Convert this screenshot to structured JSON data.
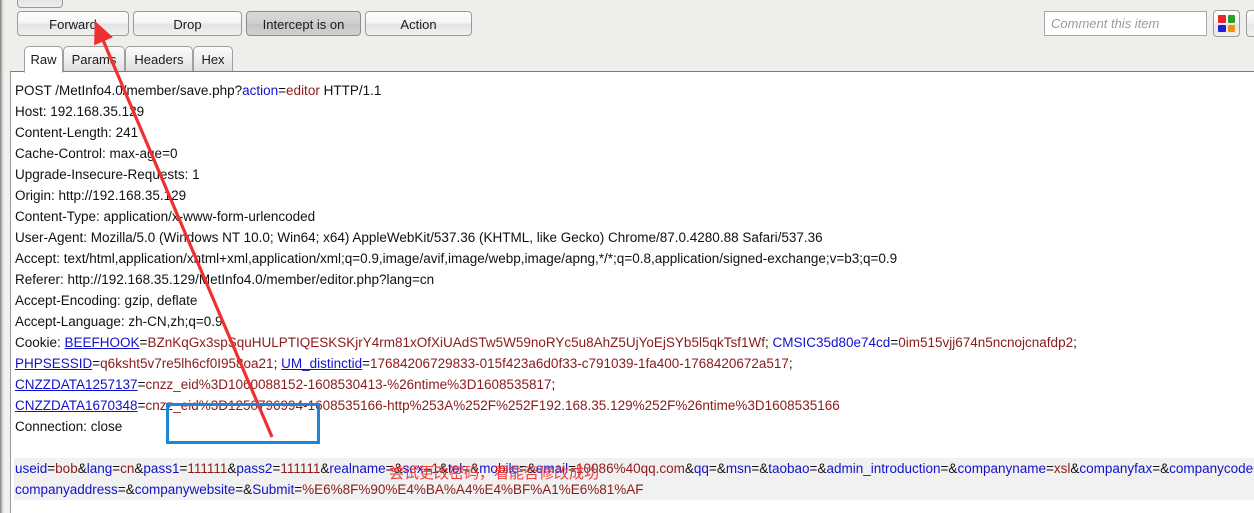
{
  "toolbar": {
    "forward_label": "Forward",
    "drop_label": "Drop",
    "intercept_label": "Intercept is on",
    "action_label": "Action",
    "comment_placeholder": "Comment this item",
    "help_glyph": "?",
    "highlight_colors": [
      "#e8272b",
      "#2aa02a",
      "#2020d0",
      "#f09014"
    ]
  },
  "tabs": [
    {
      "label": "Raw",
      "active": true
    },
    {
      "label": "Params",
      "active": false
    },
    {
      "label": "Headers",
      "active": false
    },
    {
      "label": "Hex",
      "active": false
    }
  ],
  "request": {
    "request_line": {
      "before": "POST /MetInfo4.0/member/save.php?",
      "param_name": "action",
      "eq": "=",
      "param_value": "editor",
      "after": " HTTP/1.1"
    },
    "headers": [
      "Host: 192.168.35.129",
      "Content-Length: 241",
      "Cache-Control: max-age=0",
      "Upgrade-Insecure-Requests: 1",
      "Origin: http://192.168.35.129",
      "Content-Type: application/x-www-form-urlencoded",
      "User-Agent: Mozilla/5.0 (Windows NT 10.0; Win64; x64) AppleWebKit/537.36 (KHTML, like Gecko) Chrome/87.0.4280.88 Safari/537.36",
      "Accept: text/html,application/xhtml+xml,application/xml;q=0.9,image/avif,image/webp,image/apng,*/*;q=0.8,application/signed-exchange;v=b3;q=0.9",
      "Referer: http://192.168.35.129/MetInfo4.0/member/editor.php?lang=cn",
      "Accept-Encoding: gzip, deflate",
      "Accept-Language: zh-CN,zh;q=0.9"
    ],
    "cookie_lines": [
      [
        {
          "t": "Cookie: ",
          "c": "plain"
        },
        {
          "t": "BEEFHOOK",
          "c": "key-underline"
        },
        {
          "t": "=",
          "c": "plain"
        },
        {
          "t": "BZnKqGx3spSquHULPTIQESKSKjrY4rm81xOfXiUAdSTw5W59noRYc5u8AhZ5UjYoEjSYb5l5qkTsf1Wf",
          "c": "value"
        },
        {
          "t": "; ",
          "c": "plain"
        },
        {
          "t": "CMSIC35d80e74cd",
          "c": "key"
        },
        {
          "t": "=",
          "c": "plain"
        },
        {
          "t": "0im515vjj674n5ncnojcnafdp2",
          "c": "value"
        },
        {
          "t": ";",
          "c": "plain"
        }
      ],
      [
        {
          "t": "PHPSESSID",
          "c": "key-underline"
        },
        {
          "t": "=",
          "c": "plain"
        },
        {
          "t": "q6ksht5v7re5lh6cf0I958oa21",
          "c": "value"
        },
        {
          "t": "; ",
          "c": "plain"
        },
        {
          "t": "UM_distinctid",
          "c": "key-underline"
        },
        {
          "t": "=",
          "c": "plain"
        },
        {
          "t": "17684206729833-015f423a6d0f33-c791039-1fa400-1768420672a517",
          "c": "value"
        },
        {
          "t": ";",
          "c": "plain"
        }
      ],
      [
        {
          "t": "CNZZDATA1257137",
          "c": "key-underline"
        },
        {
          "t": "=",
          "c": "plain"
        },
        {
          "t": "cnzz_eid%3D1060088152-1608530413-%26ntime%3D1608535817",
          "c": "value"
        },
        {
          "t": ";",
          "c": "plain"
        }
      ],
      [
        {
          "t": "CNZZDATA1670348",
          "c": "key-underline"
        },
        {
          "t": "=",
          "c": "plain"
        },
        {
          "t": "cnzz_eid%3D1250796994-1608535166-http%253A%252F%252F192.168.35.129%252F%26ntime%3D1608535166",
          "c": "value"
        }
      ],
      [
        {
          "t": "Connection: close",
          "c": "plain"
        }
      ]
    ],
    "body_lines": [
      [
        {
          "t": "useid",
          "c": "key"
        },
        {
          "t": "=",
          "c": "plain"
        },
        {
          "t": "bob",
          "c": "value"
        },
        {
          "t": "&",
          "c": "plain"
        },
        {
          "t": "lang",
          "c": "key"
        },
        {
          "t": "=",
          "c": "plain"
        },
        {
          "t": "cn",
          "c": "value"
        },
        {
          "t": "&",
          "c": "plain"
        },
        {
          "t": "pass1",
          "c": "key"
        },
        {
          "t": "=",
          "c": "plain"
        },
        {
          "t": "111111",
          "c": "value"
        },
        {
          "t": "&",
          "c": "plain"
        },
        {
          "t": "pass2",
          "c": "key"
        },
        {
          "t": "=",
          "c": "plain"
        },
        {
          "t": "111111",
          "c": "value"
        },
        {
          "t": "&",
          "c": "plain"
        },
        {
          "t": "realname",
          "c": "key"
        },
        {
          "t": "=",
          "c": "plain"
        },
        {
          "t": "&",
          "c": "plain"
        },
        {
          "t": "sex",
          "c": "key"
        },
        {
          "t": "=",
          "c": "plain"
        },
        {
          "t": "1",
          "c": "value"
        },
        {
          "t": "&",
          "c": "plain"
        },
        {
          "t": "tel",
          "c": "key"
        },
        {
          "t": "=",
          "c": "plain"
        },
        {
          "t": "&",
          "c": "plain"
        },
        {
          "t": "mobile",
          "c": "key"
        },
        {
          "t": "=",
          "c": "plain"
        },
        {
          "t": "&",
          "c": "plain"
        },
        {
          "t": "email",
          "c": "key"
        },
        {
          "t": "=",
          "c": "plain"
        },
        {
          "t": "10086%40qq.com",
          "c": "value"
        },
        {
          "t": "&",
          "c": "plain"
        },
        {
          "t": "qq",
          "c": "key"
        },
        {
          "t": "=",
          "c": "plain"
        },
        {
          "t": "&",
          "c": "plain"
        },
        {
          "t": "msn",
          "c": "key"
        },
        {
          "t": "=",
          "c": "plain"
        },
        {
          "t": "&",
          "c": "plain"
        },
        {
          "t": "taobao",
          "c": "key"
        },
        {
          "t": "=",
          "c": "plain"
        },
        {
          "t": "&",
          "c": "plain"
        },
        {
          "t": "admin_introduction",
          "c": "key"
        },
        {
          "t": "=",
          "c": "plain"
        },
        {
          "t": "&",
          "c": "plain"
        },
        {
          "t": "companyname",
          "c": "key"
        },
        {
          "t": "=",
          "c": "plain"
        },
        {
          "t": "xsl",
          "c": "value"
        },
        {
          "t": "&",
          "c": "plain"
        },
        {
          "t": "companyfax",
          "c": "key"
        },
        {
          "t": "=",
          "c": "plain"
        },
        {
          "t": "&",
          "c": "plain"
        },
        {
          "t": "companycode",
          "c": "key"
        },
        {
          "t": "=",
          "c": "plain"
        },
        {
          "t": "&",
          "c": "plain"
        }
      ],
      [
        {
          "t": "companyaddress",
          "c": "key"
        },
        {
          "t": "=",
          "c": "plain"
        },
        {
          "t": "&",
          "c": "plain"
        },
        {
          "t": "companywebsite",
          "c": "key"
        },
        {
          "t": "=",
          "c": "plain"
        },
        {
          "t": "&",
          "c": "plain"
        },
        {
          "t": "Submit",
          "c": "key"
        },
        {
          "t": "=",
          "c": "plain"
        },
        {
          "t": "%E6%8F%90%E4%BA%A4%E4%BF%A1%E6%81%AF",
          "c": "value"
        }
      ]
    ]
  },
  "annotations": {
    "note_text": "尝试更改密码，看能否修改成功",
    "note_color": "#f23b3b",
    "box_color": "#1e86d6",
    "arrow_color": "#ee3030"
  }
}
